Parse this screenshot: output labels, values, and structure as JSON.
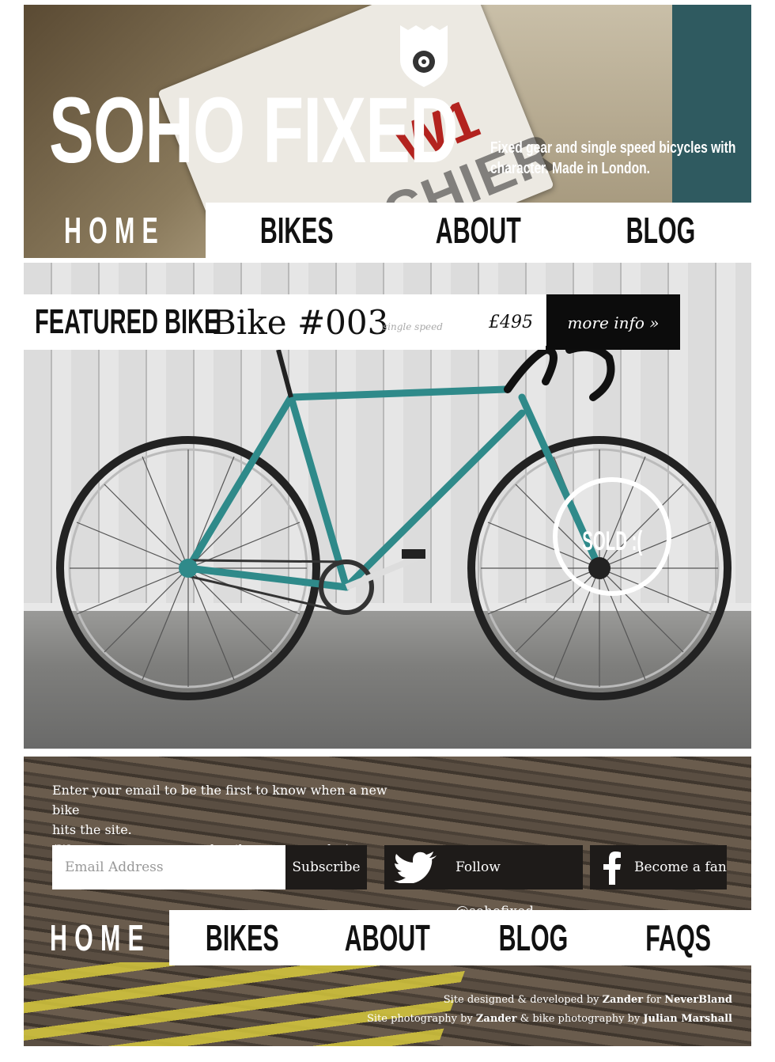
{
  "header": {
    "title": "SOHO FIXED",
    "tagline": [
      "Fixed gear and single speed bicycles with",
      "character. Made in London."
    ],
    "sign_text": "BOURCHIER STREET",
    "sign_code": "W1"
  },
  "top_nav": [
    {
      "label": "HOME"
    },
    {
      "label": "BIKES"
    },
    {
      "label": "ABOUT"
    },
    {
      "label": "BLOG"
    }
  ],
  "featured": {
    "label": "FEATURED BIKE",
    "name": "Bike #003",
    "type": "single speed",
    "price": "£495",
    "more_info": "more info »",
    "sold": "SOLD :("
  },
  "signup": {
    "text_line1": "Enter your email to be the first to know when a new bike",
    "text_line2": "hits the site.",
    "text_line3": "(We never pass on your details to anyone else)",
    "email_placeholder": "Email Address",
    "subscribe": "Subscribe",
    "twitter": "Follow @sohofixed",
    "facebook": "Become a fan"
  },
  "bottom_nav": [
    {
      "label": "HOME"
    },
    {
      "label": "BIKES"
    },
    {
      "label": "ABOUT"
    },
    {
      "label": "BLOG"
    },
    {
      "label": "FAQS"
    }
  ],
  "credits": {
    "line1_prefix": "Site designed & developed by",
    "line1_name": "Zander",
    "line1_mid": "for",
    "line1_company": "NeverBland",
    "line2_prefix": "Site photography by",
    "line2_name": "Zander",
    "line2_mid": "& bike photography by",
    "line2_photographer": "Julian Marshall"
  },
  "colors": {
    "nav_background": "#ffffff",
    "button_dark": "#0c0c0c",
    "bike_frame": "#2f8a8a"
  }
}
